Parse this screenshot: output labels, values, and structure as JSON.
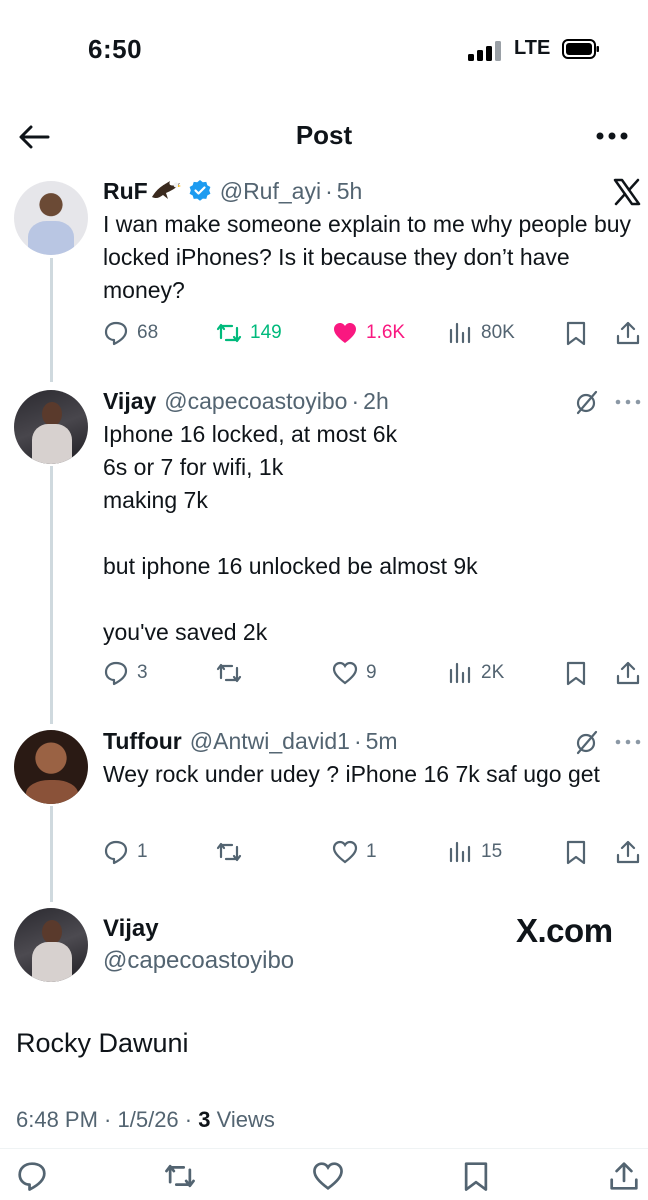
{
  "status_bar": {
    "time": "6:50",
    "network": "LTE"
  },
  "header": {
    "title": "Post"
  },
  "tweets": [
    {
      "name": "RuF",
      "handle": "@Ruf_ayi",
      "time": "5h",
      "text": [
        "I wan make someone explain to me why people buy locked iPhones? Is it because they don’t have money?"
      ],
      "replies": "68",
      "reposts": "149",
      "likes": "1.6K",
      "views": "80K"
    },
    {
      "name": "Vijay",
      "handle": "@capecoastoyibo",
      "time": "2h",
      "text": [
        "Iphone 16 locked, at most 6k",
        "6s or 7 for wifi, 1k",
        "making 7k",
        "",
        "but iphone 16 unlocked be almost 9k",
        "",
        "you've saved 2k"
      ],
      "replies": "3",
      "reposts": "",
      "likes": "9",
      "views": "2K"
    },
    {
      "name": "Tuffour",
      "handle": "@Antwi_david1",
      "time": "5m",
      "text": [
        "Wey rock under udey ? iPhone 16 7k saf ugo get"
      ],
      "replies": "1",
      "reposts": "",
      "likes": "1",
      "views": "15"
    }
  ],
  "main_post": {
    "name": "Vijay",
    "handle": "@capecoastoyibo",
    "watermark": "X.com",
    "text": "Rocky Dawuni",
    "time": "6:48 PM",
    "date": "1/5/26",
    "views_count": "3",
    "views_label": "Views"
  },
  "colors": {
    "accent_blue": "#1d9bf0",
    "repost_green": "#00ba7c",
    "like_pink": "#f91880",
    "muted": "#536471"
  }
}
